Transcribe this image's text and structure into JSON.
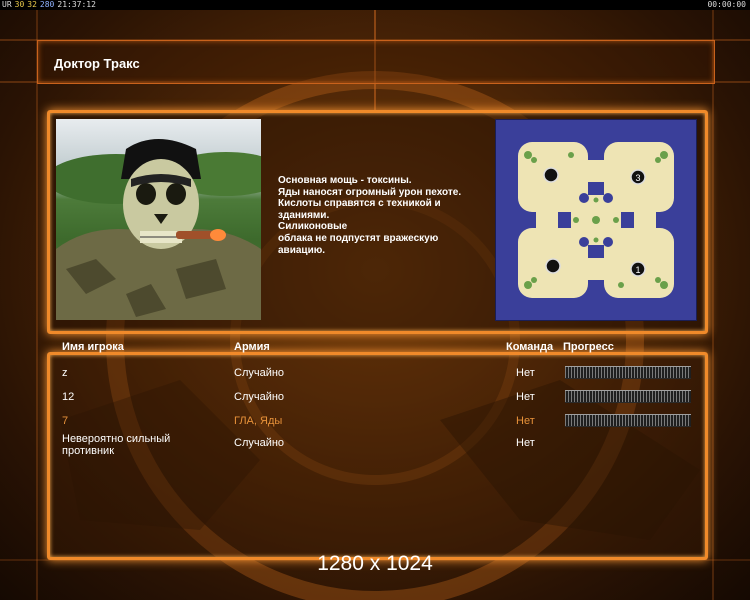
{
  "hud": {
    "stats": [
      {
        "text": "UR",
        "color": "w"
      },
      {
        "text": "30",
        "color": "y"
      },
      {
        "text": "32",
        "color": "y"
      },
      {
        "text": "280",
        "color": "b"
      },
      {
        "text": "21:37:12",
        "color": "w"
      }
    ],
    "timer": "00:00:00"
  },
  "general": {
    "name": "Доктор Тракс",
    "description": "Основная мощь - токсины.\nЯды наносят огромный урон пехоте.\nКислоты справятся с техникой и\n зданиями.\nСиликоновые\nоблака не подпустят вражескую\n авиацию."
  },
  "players_table": {
    "headers": {
      "name": "Имя игрока",
      "army": "Армия",
      "team": "Команда",
      "progress": "Прогресс"
    },
    "rows": [
      {
        "name": "z",
        "army": "Случайно",
        "team": "Нет",
        "highlight": false,
        "has_progress": true
      },
      {
        "name": "12",
        "army": "Случайно",
        "team": "Нет",
        "highlight": false,
        "has_progress": true
      },
      {
        "name": "7",
        "army": "ГЛА, Яды",
        "team": "Нет",
        "highlight": true,
        "has_progress": true
      },
      {
        "name": "Невероятно сильный\n противник",
        "army": "Случайно",
        "team": "Нет",
        "highlight": false,
        "has_progress": false
      }
    ]
  },
  "minimap": {
    "start_positions": [
      "",
      "3",
      "",
      "1"
    ]
  },
  "resolution": "1280 x 1024",
  "colors": {
    "frame": "#f08a2a",
    "highlight_text": "#e8923a",
    "map_water": "#3a3f9a",
    "map_sand": "#eee4b4"
  }
}
